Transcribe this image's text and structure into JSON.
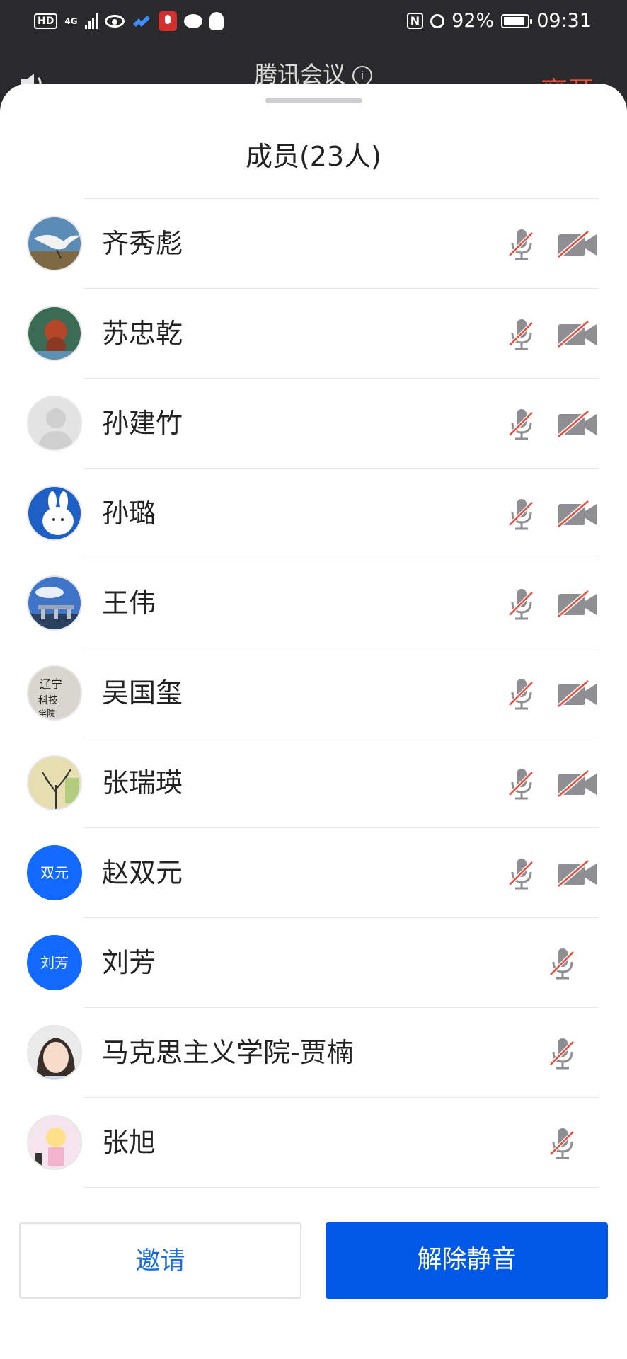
{
  "status_bar": {
    "hd_badge": "HD",
    "network": "4G",
    "battery_percent": "92%",
    "battery_level": 0.92,
    "time": "09:31",
    "icons": [
      "hd-icon",
      "signal-icon",
      "eye-icon",
      "kuaiyu-icon",
      "recorder-icon",
      "chat-icon",
      "qq-icon",
      "nfc-icon",
      "alarm-icon",
      "battery-icon"
    ]
  },
  "meeting_bar": {
    "title": "腾讯会议",
    "leave_label": "离开"
  },
  "sheet": {
    "title": "成员(23人)"
  },
  "members": [
    {
      "name": "齐秀彪",
      "avatar": "photo-seagull",
      "mic_muted": true,
      "show_camera": true,
      "camera_off": true
    },
    {
      "name": "苏忠乾",
      "avatar": "photo-toy",
      "mic_muted": true,
      "show_camera": true,
      "camera_off": true
    },
    {
      "name": "孙建竹",
      "avatar": "default-person",
      "mic_muted": true,
      "show_camera": true,
      "camera_off": true
    },
    {
      "name": "孙璐",
      "avatar": "photo-rabbit",
      "mic_muted": true,
      "show_camera": true,
      "camera_off": true
    },
    {
      "name": "王伟",
      "avatar": "photo-building",
      "mic_muted": true,
      "show_camera": true,
      "camera_off": true
    },
    {
      "name": "吴国玺",
      "avatar": "photo-calligraphy",
      "avatar_text": "辽宁科技学院",
      "mic_muted": true,
      "show_camera": true,
      "camera_off": true
    },
    {
      "name": "张瑞瑛",
      "avatar": "photo-tree",
      "mic_muted": true,
      "show_camera": true,
      "camera_off": true
    },
    {
      "name": "赵双元",
      "avatar": "text",
      "avatar_text": "双元",
      "mic_muted": true,
      "show_camera": true,
      "camera_off": true
    },
    {
      "name": "刘芳",
      "avatar": "text",
      "avatar_text": "刘芳",
      "mic_muted": true,
      "show_camera": false
    },
    {
      "name": "马克思主义学院-贾楠",
      "avatar": "photo-girl",
      "mic_muted": true,
      "show_camera": false
    },
    {
      "name": "张旭",
      "avatar": "photo-cartoon",
      "mic_muted": true,
      "show_camera": false
    }
  ],
  "buttons": {
    "invite": "邀请",
    "unmute": "解除静音"
  },
  "colors": {
    "accent_blue": "#0058e6",
    "invite_text": "#1a6ee0",
    "muted_slash": "#e74c3c",
    "icon_gray": "#8e8e93"
  }
}
